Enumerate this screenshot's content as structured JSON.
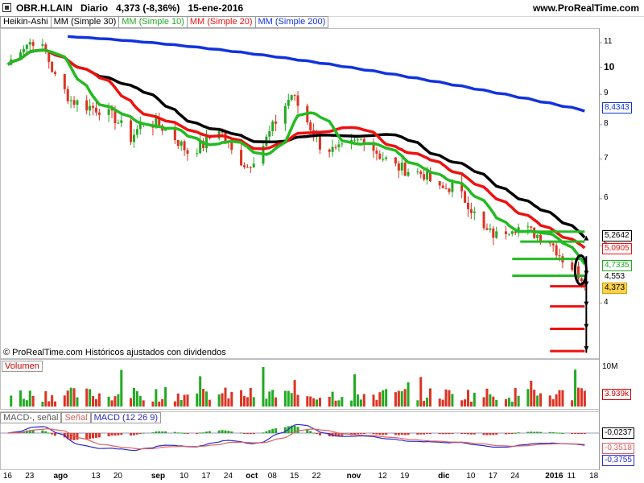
{
  "header": {
    "symbol": "OBR.H.LAIN",
    "period": "Diario",
    "quote": "4,373 (-8,36%)",
    "date": "15-ene-2016",
    "site": "www.ProRealTime.com"
  },
  "legend": {
    "heikin": "Heikin-Ashi",
    "mm30": "MM (Simple 30)",
    "mm10": "MM (Simple 10)",
    "mm20": "MM (Simple 20)",
    "mm200": "MM (Simple 200)"
  },
  "colors": {
    "up": "#22aa22",
    "down": "#dd3322",
    "mm10": "#22bb22",
    "mm20": "#ee1111",
    "mm30": "#000000",
    "mm200": "#1133dd",
    "macd": "#2a2acc",
    "signal": "#e06060"
  },
  "footer_note": "© ProRealTime.com Históricos ajustados con dividendos",
  "price_axis_ticks": [
    "11",
    "10",
    "9",
    "8",
    "7",
    "6",
    "5",
    "4"
  ],
  "price_labels": {
    "mm200": "8,4343",
    "mm30": "5,2642",
    "mm20": "5,0905",
    "mm10": "4,7335",
    "prev": "4,553",
    "last": "4,373"
  },
  "volume": {
    "title": "Volumen",
    "ticks": [
      "10M"
    ],
    "last": "3.939k"
  },
  "macd_pane": {
    "labels": [
      "MACD-, señal",
      "Señal",
      "MACD (12 26 9)"
    ],
    "values": [
      "-0,0237",
      "-0,3518",
      "-0,3755"
    ]
  },
  "x_axis": [
    "16",
    "23",
    "ago",
    "13",
    "20",
    "sep",
    "10",
    "17",
    "24",
    "oct",
    "08",
    "15",
    "22",
    "nov",
    "12",
    "19",
    "dic",
    "10",
    "17",
    "24",
    "2016",
    "11",
    "18"
  ],
  "chart_data": {
    "type": "heikin-ashi candlestick",
    "symbol": "OBR.H.LAIN",
    "timeframe": "Diario",
    "date_range": [
      "16-jul-2015",
      "15-ene-2016"
    ],
    "close_path": [
      {
        "date": "2015-07-16",
        "close": 10.1
      },
      {
        "date": "2015-07-20",
        "close": 10.8
      },
      {
        "date": "2015-07-24",
        "close": 11.1
      },
      {
        "date": "2015-07-28",
        "close": 10.6
      },
      {
        "date": "2015-07-31",
        "close": 9.6
      },
      {
        "date": "2015-08-05",
        "close": 8.8
      },
      {
        "date": "2015-08-10",
        "close": 8.6
      },
      {
        "date": "2015-08-14",
        "close": 8.5
      },
      {
        "date": "2015-08-19",
        "close": 8.2
      },
      {
        "date": "2015-08-24",
        "close": 7.6
      },
      {
        "date": "2015-08-28",
        "close": 8.1
      },
      {
        "date": "2015-09-02",
        "close": 8.0
      },
      {
        "date": "2015-09-07",
        "close": 7.6
      },
      {
        "date": "2015-09-11",
        "close": 7.2
      },
      {
        "date": "2015-09-16",
        "close": 7.4
      },
      {
        "date": "2015-09-21",
        "close": 7.9
      },
      {
        "date": "2015-09-25",
        "close": 7.2
      },
      {
        "date": "2015-09-30",
        "close": 6.8
      },
      {
        "date": "2015-10-05",
        "close": 7.4
      },
      {
        "date": "2015-10-09",
        "close": 8.1
      },
      {
        "date": "2015-10-14",
        "close": 9.0
      },
      {
        "date": "2015-10-19",
        "close": 8.1
      },
      {
        "date": "2015-10-23",
        "close": 7.4
      },
      {
        "date": "2015-10-28",
        "close": 7.2
      },
      {
        "date": "2015-11-02",
        "close": 7.4
      },
      {
        "date": "2015-11-06",
        "close": 7.6
      },
      {
        "date": "2015-11-11",
        "close": 7.1
      },
      {
        "date": "2015-11-16",
        "close": 6.8
      },
      {
        "date": "2015-11-20",
        "close": 6.7
      },
      {
        "date": "2015-11-25",
        "close": 6.6
      },
      {
        "date": "2015-11-30",
        "close": 6.2
      },
      {
        "date": "2015-12-04",
        "close": 6.3
      },
      {
        "date": "2015-12-09",
        "close": 5.9
      },
      {
        "date": "2015-12-14",
        "close": 5.3
      },
      {
        "date": "2015-12-18",
        "close": 5.2
      },
      {
        "date": "2015-12-23",
        "close": 5.4
      },
      {
        "date": "2015-12-28",
        "close": 5.3
      },
      {
        "date": "2016-01-04",
        "close": 5.1
      },
      {
        "date": "2016-01-08",
        "close": 4.75
      },
      {
        "date": "2016-01-12",
        "close": 4.55
      },
      {
        "date": "2016-01-15",
        "close": 4.373
      }
    ],
    "moving_averages": [
      {
        "name": "MM (Simple 10)",
        "last": 4.7335
      },
      {
        "name": "MM (Simple 20)",
        "last": 5.0905
      },
      {
        "name": "MM (Simple 30)",
        "last": 5.2642
      },
      {
        "name": "MM (Simple 200)",
        "last": 8.4343
      }
    ],
    "y_axis": {
      "scale": "log",
      "range": [
        3.25,
        11.6
      ],
      "ticks": [
        4,
        5,
        6,
        7,
        8,
        9,
        10,
        11
      ]
    },
    "macd": {
      "histogram": -0.0237,
      "signal": -0.3518,
      "macd": -0.3755
    },
    "volume_last": "3.939k",
    "support_levels": [
      5.28,
      5.08,
      4.75,
      4.45
    ],
    "targets": [
      4.27,
      3.95,
      3.62,
      3.32
    ]
  }
}
